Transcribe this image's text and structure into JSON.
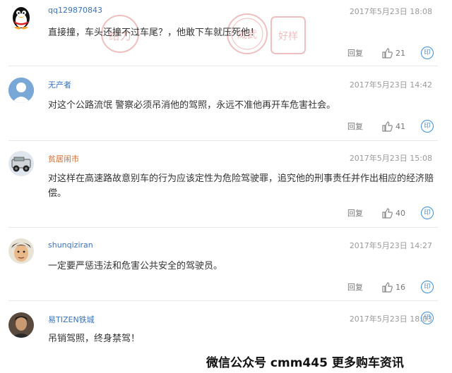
{
  "comments": [
    {
      "username": "qq129870843",
      "timestamp": "2017年5月23日 18:08",
      "text": "直接撞，车头还撞不过车尾？，他敢下车就压死他！",
      "reply_label": "回复",
      "likes": "21",
      "share_glyph": "印",
      "avatar_icon": "qq-penguin-icon"
    },
    {
      "username": "无产者",
      "timestamp": "2017年5月23日 14:42",
      "text": "对这个公路流氓 警察必须吊消他的驾照，永远不准他再开车危害社会。",
      "reply_label": "回复",
      "likes": "41",
      "share_glyph": "印",
      "avatar_icon": "default-user-icon"
    },
    {
      "username": "贫居闹市",
      "timestamp": "2017年5月23日 15:08",
      "text": "对这样在高速路故意别车的行为应该定性为危险驾驶罪，追究他的刑事责任并作出相应的经济赔偿。",
      "reply_label": "回复",
      "likes": "40",
      "share_glyph": "印",
      "avatar_icon": "jeep-avatar"
    },
    {
      "username": "shunqiziran",
      "timestamp": "2017年5月23日 14:27",
      "text": "一定要严惩违法和危害公共安全的驾驶员。",
      "reply_label": "回复",
      "likes": "16",
      "share_glyph": "印",
      "avatar_icon": "cartoon-face-avatar"
    },
    {
      "username": "易TIZEN铁城",
      "timestamp": "2017年5月23日 18:03",
      "text": "吊销驾照，终身禁驾！",
      "reply_label": "回复",
      "likes": "",
      "share_glyph": "印",
      "avatar_icon": "man-photo-avatar"
    }
  ],
  "watermark": "微信公众号 cmm445 更多购车资讯",
  "colors": {
    "username": "#3a72b8",
    "share_accent": "#3a8ed8",
    "stamp_red": "#d44a4a"
  }
}
